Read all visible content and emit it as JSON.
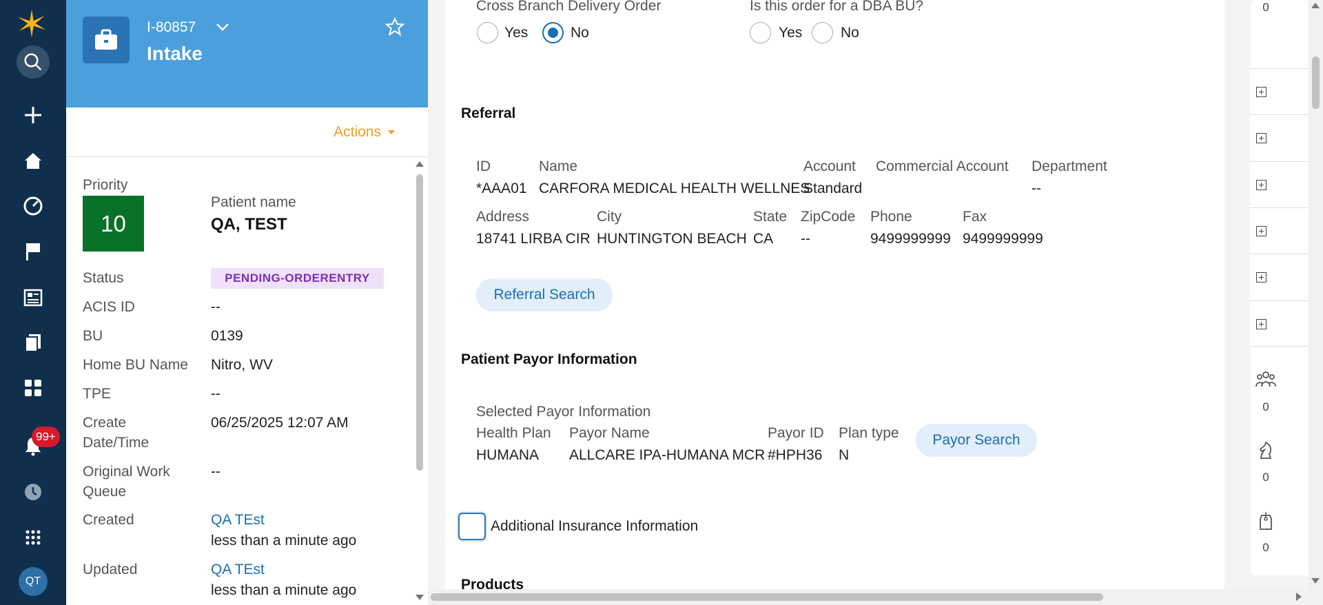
{
  "nav": {
    "badge": "99+",
    "avatar": "QT",
    "icons": [
      "app-logo-icon",
      "search-icon",
      "plus-icon",
      "home-icon",
      "dashboard-icon",
      "flag-icon",
      "news-icon",
      "documents-icon",
      "grid-icon",
      "bell-icon",
      "history-icon",
      "apps-icon"
    ]
  },
  "case": {
    "id": "I-80857",
    "type": "Intake",
    "actions_label": "Actions"
  },
  "summary": {
    "priority_label": "Priority",
    "priority_value": "10",
    "patient_label": "Patient name",
    "patient_value": "QA, TEST",
    "status_label": "Status",
    "status_value": "PENDING-ORDERENTRY",
    "acis_label": "ACIS ID",
    "acis_value": "--",
    "bu_label": "BU",
    "bu_value": "0139",
    "home_bu_label": "Home BU Name",
    "home_bu_value": "Nitro, WV",
    "tpe_label": "TPE",
    "tpe_value": "--",
    "create_label_1": "Create",
    "create_label_2": "Date/Time",
    "create_value": "06/25/2025 12:07 AM",
    "owq_label_1": "Original Work",
    "owq_label_2": "Queue",
    "owq_value": "--",
    "created_label": "Created",
    "created_by": "QA TEst",
    "created_when": "less than a minute ago",
    "updated_label": "Updated",
    "updated_by": "QA TEst",
    "updated_when": "less than a minute ago"
  },
  "form": {
    "cross_branch_label": "Cross Branch Delivery Order",
    "dba_label": "Is this order for a DBA BU?",
    "yes": "Yes",
    "no": "No",
    "cross_branch_selected": "No",
    "dba_selected": "",
    "referral": {
      "title": "Referral",
      "headers1": [
        "ID",
        "Name",
        "Account",
        "Commercial Account",
        "Department"
      ],
      "row1": [
        "*AAA01",
        "CARFORA MEDICAL HEALTH WELLNES",
        "Standard",
        "",
        "--"
      ],
      "headers2": [
        "Address",
        "City",
        "State",
        "ZipCode",
        "Phone",
        "Fax"
      ],
      "row2": [
        "18741 LIRBA CIR",
        "HUNTINGTON BEACH",
        "CA",
        "--",
        "9499999999",
        "9499999999"
      ],
      "search_button": "Referral Search"
    },
    "payor": {
      "title": "Patient Payor Information",
      "subtitle": "Selected Payor Information",
      "headers": [
        "Health Plan",
        "Payor Name",
        "Payor ID",
        "Plan type"
      ],
      "row": [
        "HUMANA",
        "ALLCARE IPA-HUMANA MCR",
        "#HPH36",
        "N"
      ],
      "search_button": "Payor Search"
    },
    "additional_insurance": "Additional Insurance Information",
    "products_title": "Products"
  },
  "rail": {
    "top_count": "0",
    "counts": [
      "0",
      "0",
      "0"
    ],
    "icons": [
      "team-icon",
      "chess-knight-icon",
      "tag-icon"
    ]
  },
  "colors": {
    "nav": "#0f2f4d",
    "header": "#4c9fdd",
    "accent": "#1a6fb3",
    "priority": "#0a7228",
    "actions": "#f0a020",
    "status_text": "#7b2db8",
    "status_bg": "#f0e1fb"
  }
}
